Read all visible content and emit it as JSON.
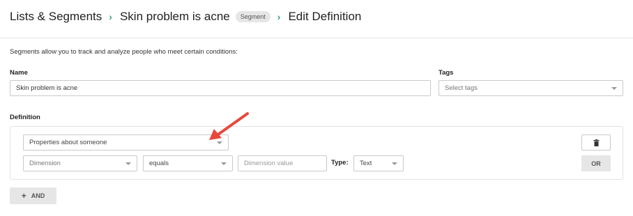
{
  "breadcrumb": {
    "root": "Lists & Segments",
    "segment_name": "Skin problem is acne",
    "segment_badge": "Segment",
    "current": "Edit Definition",
    "separator": "›"
  },
  "intro_text": "Segments allow you to track and analyze people who meet certain conditions:",
  "name_field": {
    "label": "Name",
    "value": "Skin problem is acne"
  },
  "tags_field": {
    "label": "Tags",
    "placeholder": "Select tags"
  },
  "definition": {
    "label": "Definition",
    "condition_type": "Properties about someone",
    "dimension_placeholder": "Dimension",
    "operator": "equals",
    "value_placeholder": "Dimension value",
    "type_label": "Type:",
    "type_value": "Text",
    "or_label": "OR",
    "and_label": "AND",
    "and_plus": "+"
  },
  "colors": {
    "separator_accent": "#3aa36b",
    "annotation_arrow": "#e8483c"
  },
  "icons": {
    "trash": "trash-icon",
    "arrow": "annotation-arrow-icon"
  }
}
